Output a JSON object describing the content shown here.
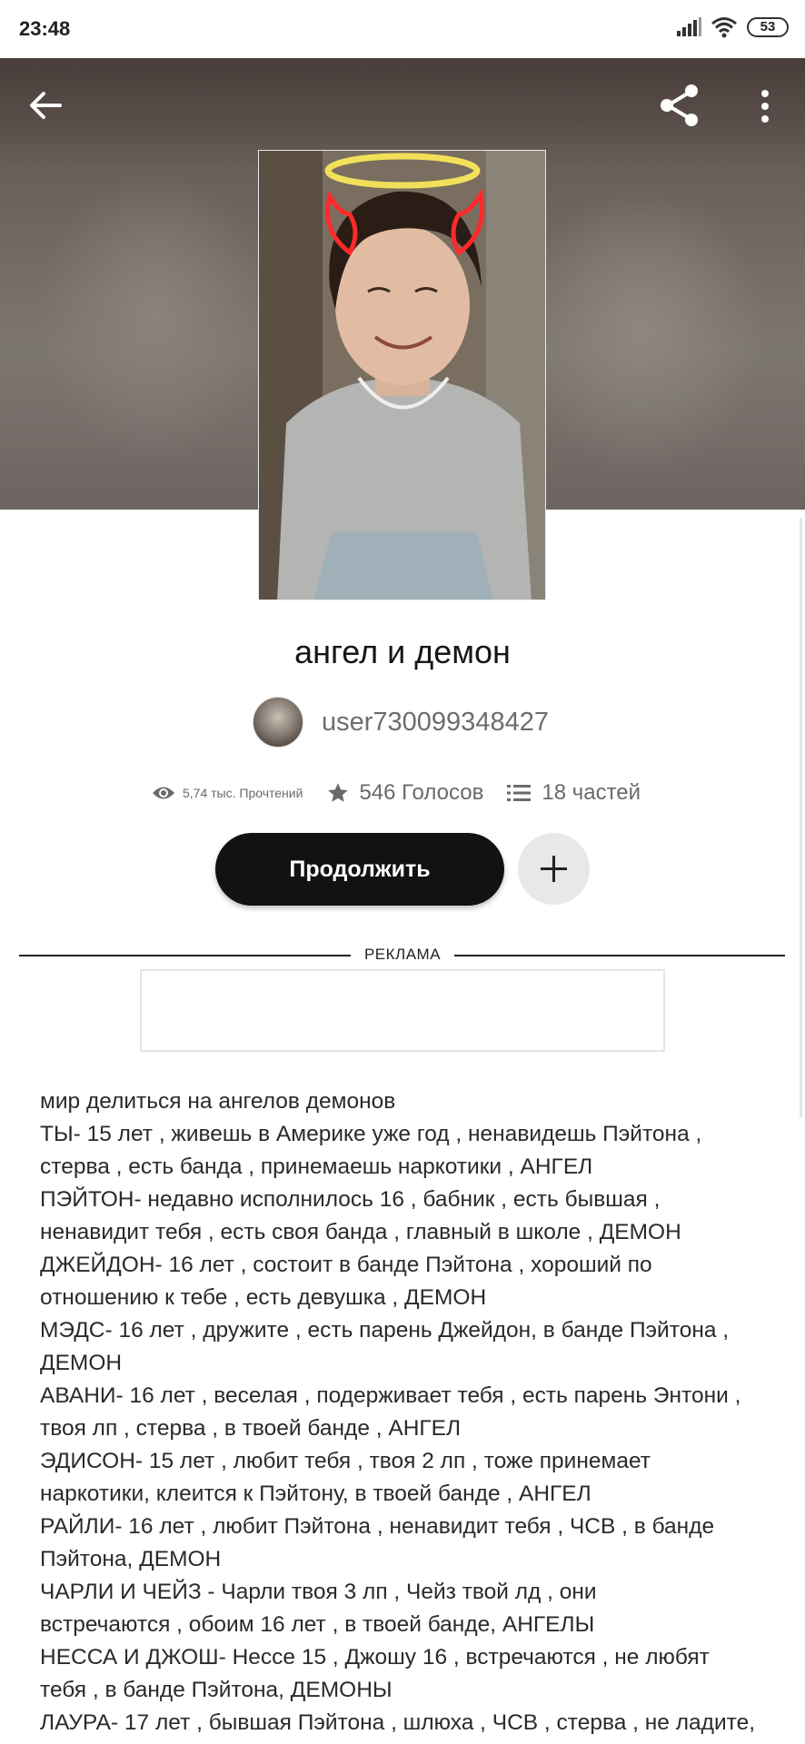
{
  "status_bar": {
    "time": "23:48",
    "battery": "53"
  },
  "header": {
    "back_icon": "arrow-left-icon",
    "share_icon": "share-icon",
    "more_icon": "more-vertical-icon"
  },
  "story": {
    "title": "ангел и демон",
    "author": "user730099348427",
    "stats": {
      "reads": "5,74 тыс. Прочтений",
      "votes": "546 Голосов",
      "parts": "18 частей"
    },
    "continue_label": "Продолжить",
    "add_icon": "plus-icon"
  },
  "ad": {
    "label": "РЕКЛАМА"
  },
  "description": {
    "lines": [
      "мир делиться на ангелов   демонов",
      "ТЫ- 15 лет , живешь в Америке уже год , ненавидешь Пэйтона ,",
      "стерва , есть банда , принемаешь наркотики , АНГЕЛ",
      "ПЭЙТОН- недавно исполнилось 16 , бабник , есть бывшая ,",
      "ненавидит тебя , есть своя банда , главный в школе , ДЕМОН",
      "ДЖЕЙДОН- 16 лет , состоит в банде Пэйтона , хороший по",
      "отношению к тебе , есть девушка , ДЕМОН",
      "МЭДС- 16 лет , дружите , есть парень Джейдон, в банде Пэйтона ,",
      "ДЕМОН",
      "АВАНИ- 16 лет , веселая , подерживает тебя , есть парень Энтони ,",
      "твоя лп , стерва , в твоей банде , АНГЕЛ",
      "ЭДИСОН- 15 лет , любит тебя , твоя 2 лп , тоже принемает",
      "наркотики, клеится к Пэйтону, в твоей банде , АНГЕЛ",
      "РАЙЛИ- 16 лет , любит Пэйтона , ненавидит тебя , ЧСВ , в банде",
      "Пэйтона, ДЕМОН",
      "ЧАРЛИ И ЧЕЙЗ - Чарли твоя 3 лп , Чейз твой лд , они",
      "встречаются , обоим 16 лет , в твоей банде, АНГЕЛЫ",
      "НЕССА И ДЖОШ- Нессе 15 , Джошу 16 , встречаются , не любят",
      "тебя , в банде Пэйтона, ДЕМОНЫ",
      "ЛАУРА- 17 лет , бывшая Пэйтона , шлюха , ЧСВ , стерва , не ладите,"
    ]
  }
}
